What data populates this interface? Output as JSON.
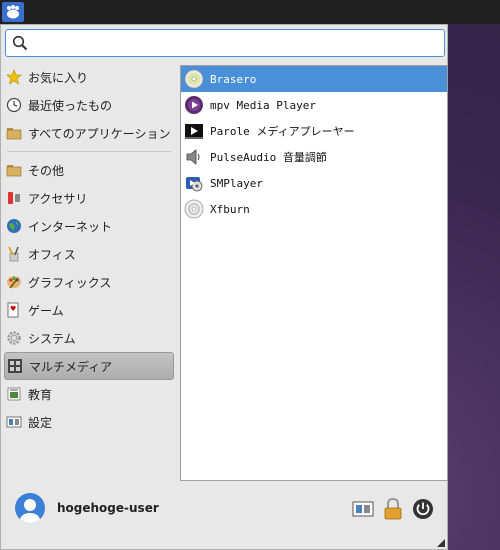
{
  "search": {
    "value": "",
    "placeholder": ""
  },
  "categories": [
    {
      "label": "お気に入り",
      "icon": "star-icon"
    },
    {
      "label": "最近使ったもの",
      "icon": "clock-icon"
    },
    {
      "label": "すべてのアプリケーション",
      "icon": "folder-icon"
    },
    {
      "label": "その他",
      "icon": "folder-icon"
    },
    {
      "label": "アクセサリ",
      "icon": "accessories-icon"
    },
    {
      "label": "インターネット",
      "icon": "globe-icon"
    },
    {
      "label": "オフィス",
      "icon": "office-icon"
    },
    {
      "label": "グラフィックス",
      "icon": "palette-icon"
    },
    {
      "label": "ゲーム",
      "icon": "game-icon"
    },
    {
      "label": "システム",
      "icon": "gear-icon"
    },
    {
      "label": "マルチメディア",
      "icon": "multimedia-icon"
    },
    {
      "label": "教育",
      "icon": "education-icon"
    },
    {
      "label": "設定",
      "icon": "settings-icon"
    }
  ],
  "selected_category": "マルチメディア",
  "apps": [
    {
      "label": "Brasero",
      "icon": "disc-icon"
    },
    {
      "label": "mpv Media Player",
      "icon": "mpv-icon"
    },
    {
      "label": "Parole メディアプレーヤー",
      "icon": "parole-icon"
    },
    {
      "label": "PulseAudio 音量調節",
      "icon": "speaker-icon"
    },
    {
      "label": "SMPlayer",
      "icon": "smplayer-icon"
    },
    {
      "label": "Xfburn",
      "icon": "burn-icon"
    }
  ],
  "selected_app": "Brasero",
  "user": {
    "name": "hogehoge-user"
  },
  "colors": {
    "accent": "#4a90d9",
    "menu_bg": "#e8e8e8",
    "selected_category_bg": "#b8b8b8"
  }
}
